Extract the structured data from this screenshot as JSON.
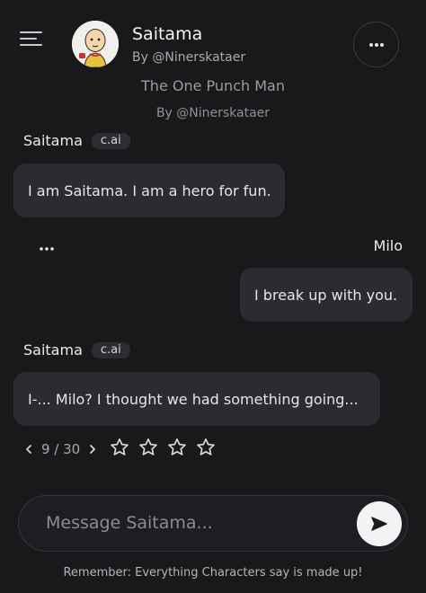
{
  "header": {
    "character_name": "Saitama",
    "creator": "By @Ninerskataer"
  },
  "intro": {
    "tagline": "The One Punch Man",
    "creator": "By @Ninerskataer"
  },
  "messages": [
    {
      "sender": "Saitama",
      "badge": "c.ai",
      "text": "I am Saitama. I am a hero for fun."
    },
    {
      "sender": "Milo",
      "text": "I break up with you."
    },
    {
      "sender": "Saitama",
      "badge": "c.ai",
      "text": "I-... Milo? I thought we had something going..."
    }
  ],
  "pager": {
    "text": "9 / 30",
    "current": 9,
    "total": 30
  },
  "rating": {
    "stars": 4,
    "filled": 0
  },
  "composer": {
    "placeholder": "Message Saitama..."
  },
  "footer": {
    "disclaimer": "Remember: Everything Characters say is made up!"
  },
  "colors": {
    "background": "#19191c",
    "bubble": "#2b2b30",
    "send_button": "#f3f3f5"
  },
  "icons": [
    "menu-icon",
    "avatar",
    "more-horizontal-icon",
    "chevron-left-icon",
    "chevron-right-icon",
    "star-outline-icon",
    "send-arrow-icon"
  ]
}
